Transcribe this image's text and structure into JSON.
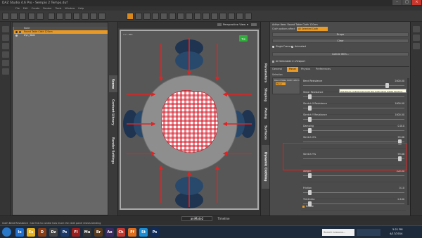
{
  "window": {
    "title": "DAZ Studio 4.6 Pro - Sempio 2 Tempo.duf"
  },
  "menu": [
    "File",
    "Edit",
    "Create",
    "Render",
    "Tools",
    "Window",
    "Help"
  ],
  "scene_tree": {
    "header": "Node",
    "rows": [
      "Round Table Cloth 120cm",
      "Dyn_Table"
    ]
  },
  "left_tabs": [
    "Scene",
    "Content Library",
    "Render Settings"
  ],
  "viewport": {
    "camera": "Perspective View",
    "nav_badge": "Top",
    "corner": "7.7 - 874"
  },
  "right_tabs": [
    "Parameters",
    "Shaping",
    "Posing",
    "Surfaces",
    "Dynamic Clothing"
  ],
  "dyn_panel": {
    "title": "Active Item: Round Table Cloth 120cm",
    "cloth_label": "Cloth options affect",
    "cloth_value": "All Selected Cloth",
    "buttons": [
      "Drape",
      "Clear",
      "Collide With..."
    ],
    "single_frame": "Single Frame",
    "animated": "Animated",
    "filter": "All Selectable in Viewport",
    "tabs": [
      "General",
      "Panel",
      "Physics",
      "Preferences"
    ],
    "selection_label": "Selection",
    "tree_item": "Round Table Cloth 120cm",
    "tree_sub": "Panel",
    "params": [
      {
        "label": "Bend Resistance",
        "value": "2000.00",
        "pos": 0.85
      },
      {
        "label": "Shear Resistance",
        "value": "1000.00",
        "pos": 0.05
      },
      {
        "label": "Stretch X Resistance",
        "value": "1000.00",
        "pos": 0.05
      },
      {
        "label": "Stretch Y Resistance",
        "value": "1000.00",
        "pos": 0.05
      },
      {
        "label": "Damping",
        "value": "0.010",
        "pos": 0.05
      },
      {
        "label": "Stretch X%",
        "value": "99.88",
        "pos": 0.98
      },
      {
        "label": "Stretch Y%",
        "value": "99.88",
        "pos": 0.98
      },
      {
        "label": "Weight",
        "value": "100.00",
        "pos": 0.05
      },
      {
        "label": "Friction",
        "value": "0.10",
        "pos": 0.05
      },
      {
        "label": "Thickness",
        "value": "0.100",
        "pos": 0.05
      }
    ],
    "enable_label": "Enable",
    "tooltip": "Use this to control how much the cloth panel resists bending."
  },
  "bottom_tabs": [
    "aniMate2",
    "Timeline"
  ],
  "status": "Cloth Bend Resistance : Use this to control how much the cloth panel resists bending",
  "taskbar": {
    "search": "Search Lessons...",
    "time": "5:21 PM",
    "date": "4/17/2014",
    "apps": [
      {
        "name": "Ie",
        "color": "#1e6fd0"
      },
      {
        "name": "Ex",
        "color": "#e8b21c"
      },
      {
        "name": "D",
        "color": "#8a3d12"
      },
      {
        "name": "Dz",
        "color": "#444444"
      },
      {
        "name": "Ps",
        "color": "#1b3a6b"
      },
      {
        "name": "Fl",
        "color": "#9b1d1d"
      },
      {
        "name": "Mu",
        "color": "#333333"
      },
      {
        "name": "Br",
        "color": "#5b3a1b"
      },
      {
        "name": "Ae",
        "color": "#3b2a62"
      },
      {
        "name": "Ch",
        "color": "#c8372d"
      },
      {
        "name": "Ff",
        "color": "#e16c19"
      },
      {
        "name": "St",
        "color": "#1a8fd6"
      },
      {
        "name": "Ps",
        "color": "#0f2c5b"
      }
    ]
  },
  "colors": {
    "accent": "#e89a25",
    "highlight": "#e02020",
    "arrow": "#e02424",
    "cloth_red": "#d41f2d"
  }
}
